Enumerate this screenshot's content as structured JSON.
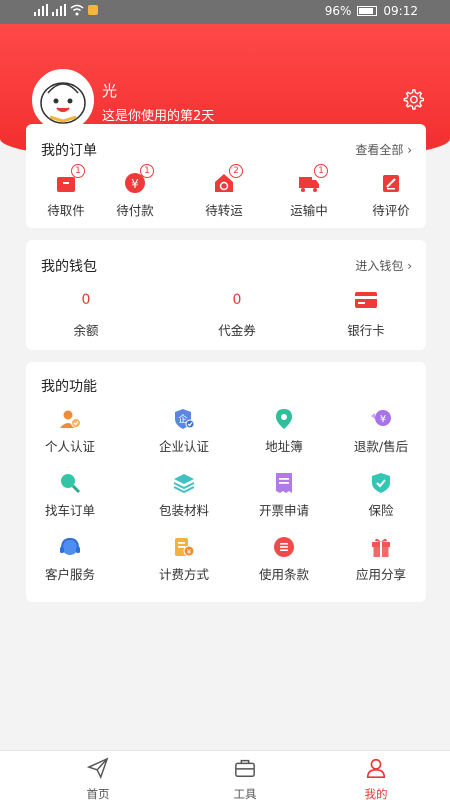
{
  "status": {
    "battery": "96%",
    "time": "09:12"
  },
  "profile": {
    "name": "光",
    "subtitle": "这是你使用的第2天"
  },
  "orders": {
    "title": "我的订单",
    "view_all": "查看全部",
    "items": [
      {
        "label": "待取件",
        "badge": "1",
        "icon": "box-pickup-icon"
      },
      {
        "label": "待付款",
        "badge": "1",
        "icon": "yuan-payment-icon"
      },
      {
        "label": "待转运",
        "badge": "2",
        "icon": "transfer-house-icon"
      },
      {
        "label": "运输中",
        "badge": "1",
        "icon": "truck-icon"
      },
      {
        "label": "待评价",
        "badge": "",
        "icon": "edit-review-icon"
      }
    ]
  },
  "wallet": {
    "title": "我的钱包",
    "enter": "进入钱包",
    "balance_value": "0",
    "balance_label": "余额",
    "voucher_value": "0",
    "voucher_label": "代金券",
    "bank_label": "银行卡"
  },
  "functions": {
    "title": "我的功能",
    "items": [
      {
        "label": "个人认证",
        "icon": "person-verify-icon"
      },
      {
        "label": "企业认证",
        "icon": "enterprise-verify-icon"
      },
      {
        "label": "地址簿",
        "icon": "location-pin-icon"
      },
      {
        "label": "退款/售后",
        "icon": "refund-icon"
      },
      {
        "label": "找车订单",
        "icon": "search-car-icon"
      },
      {
        "label": "包装材料",
        "icon": "layers-icon"
      },
      {
        "label": "开票申请",
        "icon": "invoice-icon"
      },
      {
        "label": "保险",
        "icon": "shield-check-icon"
      },
      {
        "label": "客户服务",
        "icon": "headset-icon"
      },
      {
        "label": "计费方式",
        "icon": "billing-icon"
      },
      {
        "label": "使用条款",
        "icon": "terms-list-icon"
      },
      {
        "label": "应用分享",
        "icon": "gift-icon"
      }
    ]
  },
  "nav": {
    "home": "首页",
    "tools": "工具",
    "mine": "我的"
  },
  "colors": {
    "brand_red": "#f23131",
    "active": "#e53935"
  }
}
